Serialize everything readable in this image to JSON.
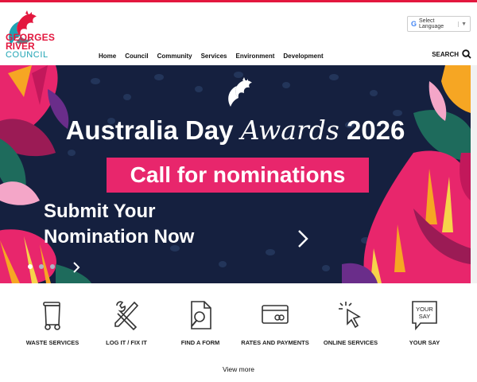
{
  "logo": {
    "line1": "GEORGES",
    "line2": "RIVER",
    "line3": "COUNCIL"
  },
  "language": {
    "label": "Select Language",
    "g": "G",
    "arrow": "▼"
  },
  "nav": {
    "items": [
      "Home",
      "Council",
      "Community",
      "Services",
      "Environment",
      "Development"
    ]
  },
  "search": {
    "label": "SEARCH"
  },
  "hero": {
    "title_left": "Australia Day ",
    "title_mid": "Awards",
    "title_right": " 2026",
    "call": "Call for nominations",
    "submit_line1": "Submit Your",
    "submit_line2": "Nomination Now",
    "slides_total": 3,
    "slide_active": 1
  },
  "quick_links": [
    {
      "label": "WASTE SERVICES",
      "icon": "bin-icon"
    },
    {
      "label": "LOG IT / FIX IT",
      "icon": "tools-icon"
    },
    {
      "label": "FIND A FORM",
      "icon": "document-search-icon"
    },
    {
      "label": "RATES AND PAYMENTS",
      "icon": "credit-card-icon"
    },
    {
      "label": "ONLINE SERVICES",
      "icon": "cursor-click-icon"
    },
    {
      "label": "YOUR SAY",
      "icon": "your-say-icon",
      "icon_text": "YOUR SAY"
    }
  ],
  "view_more": "View more",
  "colors": {
    "brand_red": "#e3173e",
    "brand_teal": "#1fa4b4",
    "hero_bg": "#15203f",
    "call_pink": "#e8266c"
  }
}
